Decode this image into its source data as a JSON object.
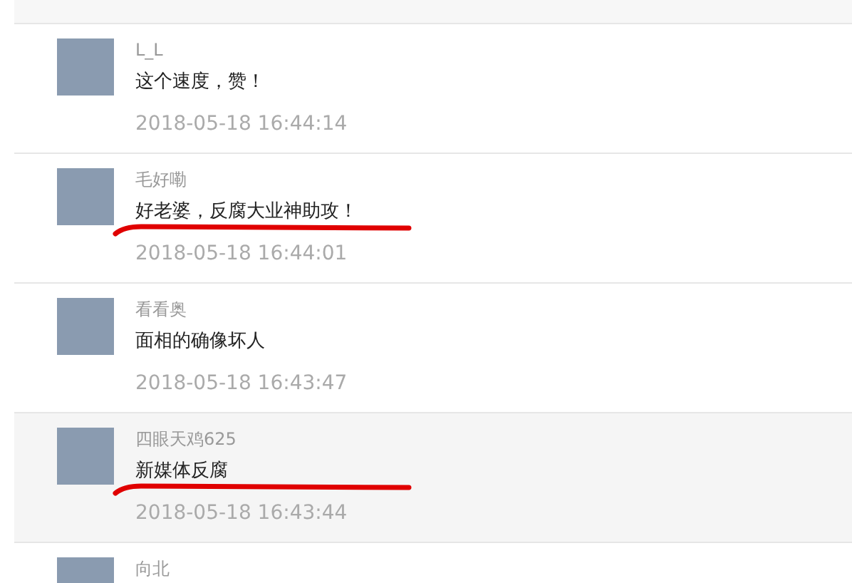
{
  "comments": [
    {
      "author": "L_L",
      "text": "这个速度，赞！",
      "time": "2018-05-18 16:44:14",
      "highlighted": false,
      "underlined": false
    },
    {
      "author": "毛好嘞",
      "text": "好老婆，反腐大业神助攻！",
      "time": "2018-05-18 16:44:01",
      "highlighted": false,
      "underlined": true
    },
    {
      "author": "看看奥",
      "text": "面相的确像坏人",
      "time": "2018-05-18 16:43:47",
      "highlighted": false,
      "underlined": false
    },
    {
      "author": "四眼天鸡625",
      "text": "新媒体反腐",
      "time": "2018-05-18 16:43:44",
      "highlighted": true,
      "underlined": true
    },
    {
      "author": "向北"
    }
  ]
}
